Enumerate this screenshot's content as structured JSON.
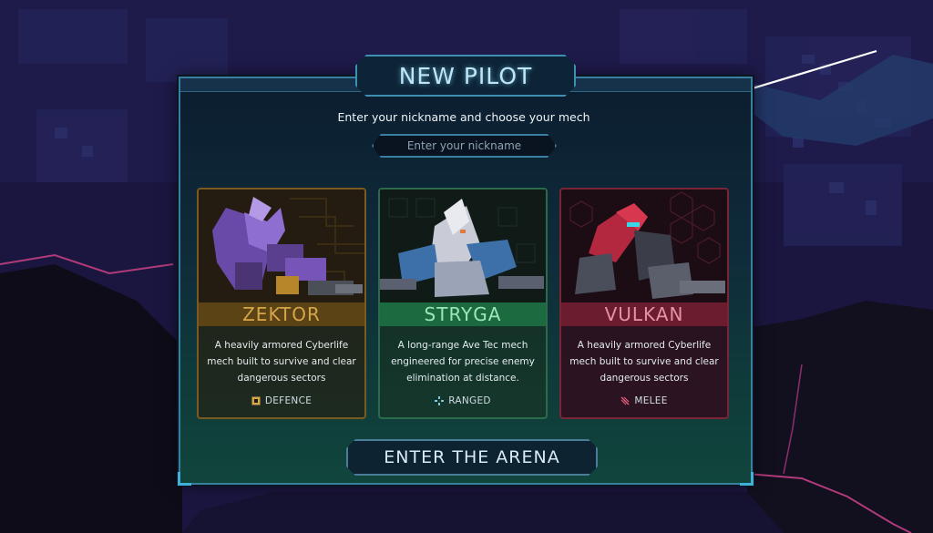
{
  "dialog": {
    "title": "NEW PILOT",
    "subtitle": "Enter your nickname and choose your mech",
    "nickname_placeholder": "Enter your nickname",
    "nickname_value": ""
  },
  "mechs": [
    {
      "name": "ZEKTOR",
      "description": "A heavily armored Cyberlife mech built to survive and clear dangerous sectors",
      "role": "DEFENCE",
      "role_icon": "shield-square-icon",
      "accent": "#d6a54a"
    },
    {
      "name": "STRYGA",
      "description": "A long-range Ave Tec mech engineered for precise enemy elimination at distance.",
      "role": "RANGED",
      "role_icon": "crosshair-icon",
      "accent": "#9de6b8"
    },
    {
      "name": "VULKAN",
      "description": "A heavily armored Cyberlife mech built to survive and clear dangerous sectors",
      "role": "MELEE",
      "role_icon": "slash-icon",
      "accent": "#e691a6"
    }
  ],
  "actions": {
    "enter_label": "ENTER THE ARENA"
  },
  "colors": {
    "panel_border": "#3a7fa0",
    "title_glow": "#bfe6f6"
  }
}
